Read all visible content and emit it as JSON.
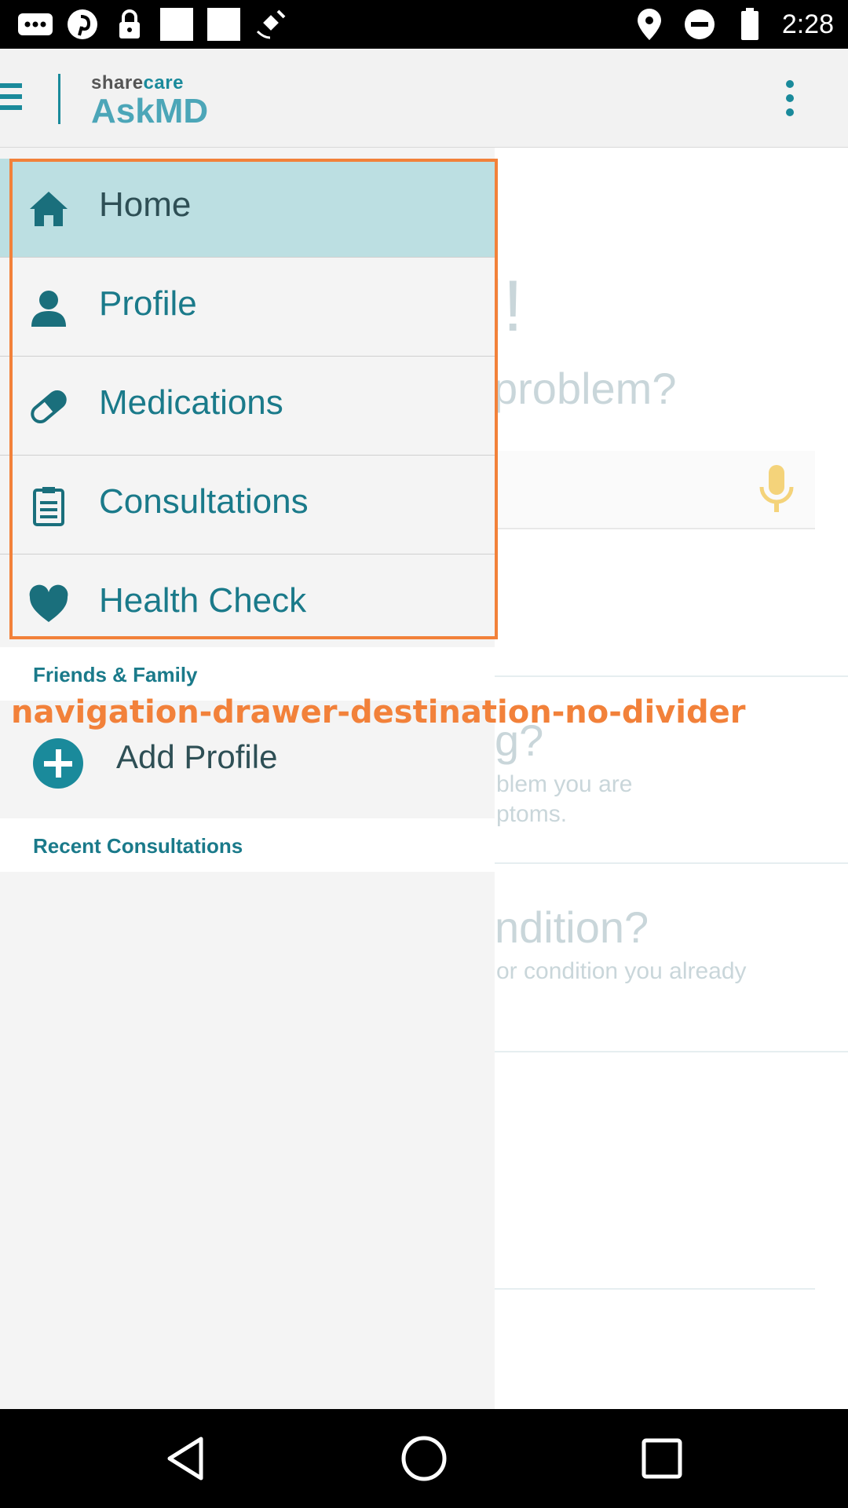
{
  "status_bar": {
    "time": "2:28",
    "icons": [
      "more-icon",
      "pinterest-icon",
      "minus-icon",
      "lock-icon",
      "square-icon",
      "square-icon",
      "satellite-icon",
      "location-icon",
      "do-not-disturb-icon",
      "battery-icon"
    ]
  },
  "app_bar": {
    "logo_prefix": "share",
    "logo_suffix": "care",
    "logo_main": "AskMD"
  },
  "background": {
    "title_fragment": "l!",
    "question_fragment": "problem?",
    "text_fragment_1": "g?",
    "text_fragment_2": "blem you are",
    "text_fragment_3": "ptoms.",
    "text_fragment_4": "ndition?",
    "text_fragment_5": "or condition you already"
  },
  "drawer": {
    "items": [
      {
        "label": "Home",
        "icon": "home-icon",
        "selected": true
      },
      {
        "label": "Profile",
        "icon": "person-icon",
        "selected": false
      },
      {
        "label": "Medications",
        "icon": "pill-icon",
        "selected": false
      },
      {
        "label": "Consultations",
        "icon": "clipboard-icon",
        "selected": false
      },
      {
        "label": "Health Check",
        "icon": "heart-icon",
        "selected": false
      }
    ],
    "friends_header": "Friends & Family",
    "add_profile_label": "Add Profile",
    "recent_header": "Recent Consultations"
  },
  "annotation": {
    "label": "navigation-drawer-destination-no-divider",
    "color": "#f2813a"
  },
  "colors": {
    "accent": "#1a8a9b",
    "selected_bg": "#bcdfe2",
    "drawer_bg": "#f4f4f4"
  }
}
